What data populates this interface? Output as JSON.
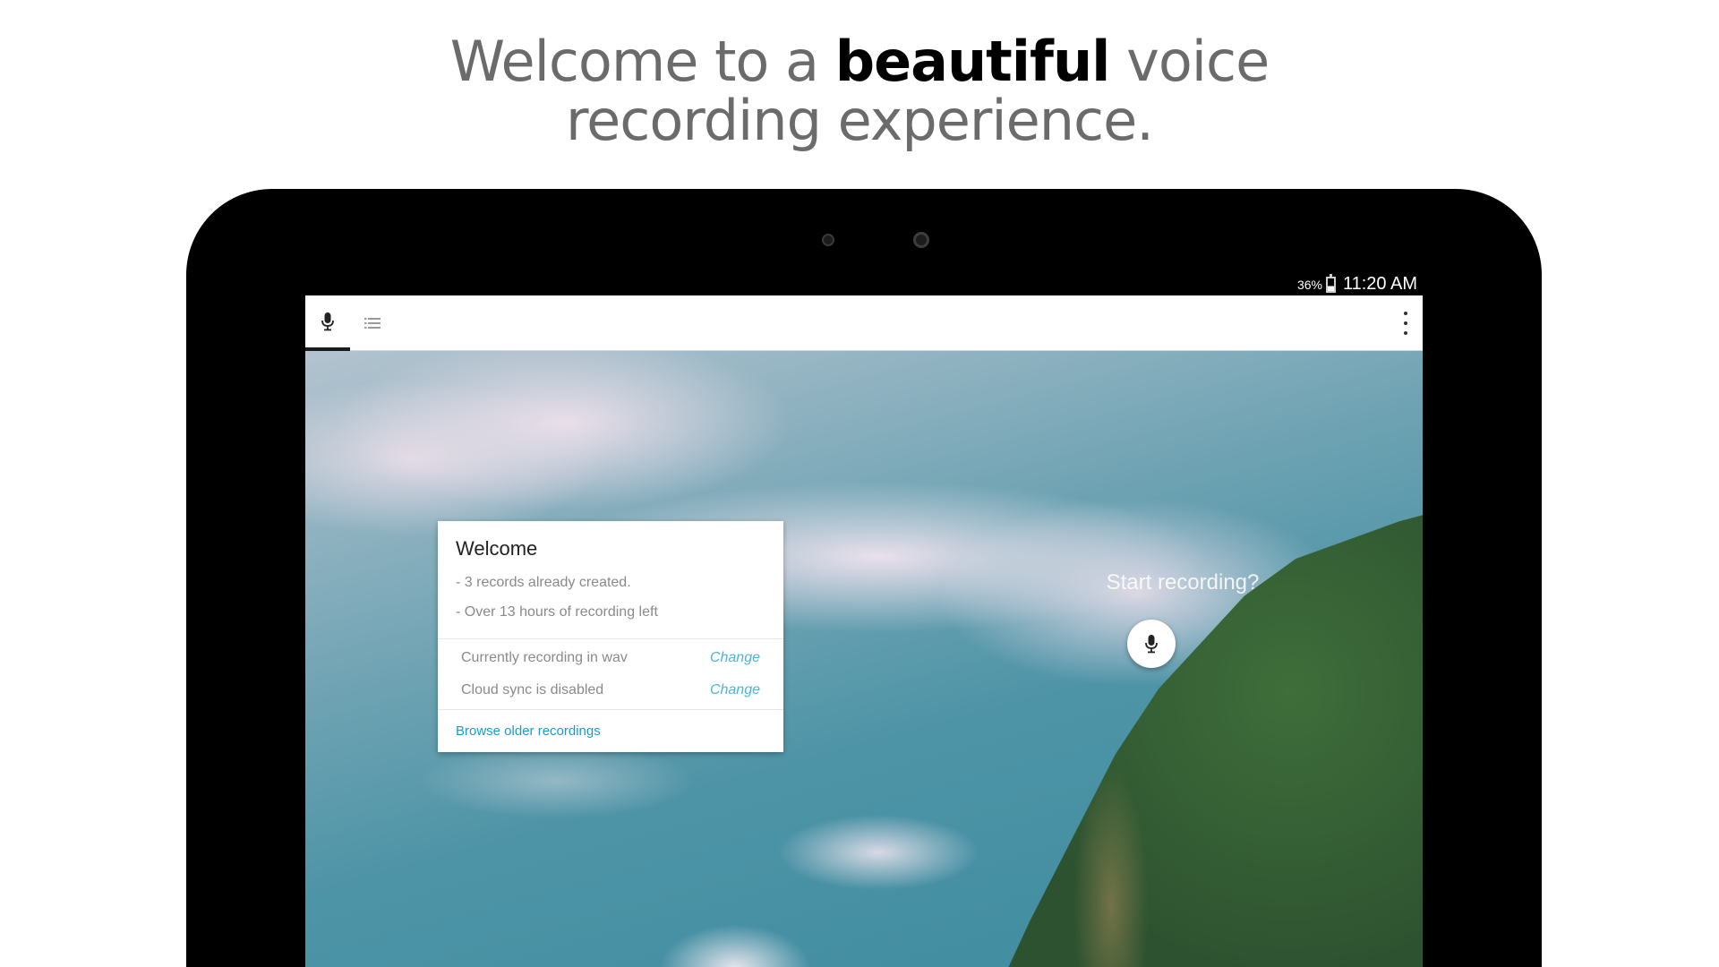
{
  "headline": {
    "line1_before": "Welcome to a ",
    "line1_bold": "beautiful",
    "line1_after": " voice",
    "line2": "recording experience."
  },
  "status_bar": {
    "battery": "36%",
    "time": "11:20 AM"
  },
  "tabs": [
    {
      "icon": "mic-icon",
      "selected": true
    },
    {
      "icon": "list-icon",
      "selected": false
    }
  ],
  "welcome_card": {
    "title": "Welcome",
    "lines": [
      "- 3 records already created.",
      "- Over 13 hours of recording left"
    ],
    "settings": [
      {
        "label": "Currently recording in wav",
        "action": "Change"
      },
      {
        "label": "Cloud sync is disabled",
        "action": "Change"
      }
    ],
    "browse_link": "Browse older recordings"
  },
  "prompt": {
    "text": "Start recording?"
  },
  "colors": {
    "headline_text": "#6b6b6b",
    "headline_bold": "#000000",
    "link": "#1a9cc8",
    "change": "#4fb3d8",
    "card_text": "#8a8a8a"
  }
}
